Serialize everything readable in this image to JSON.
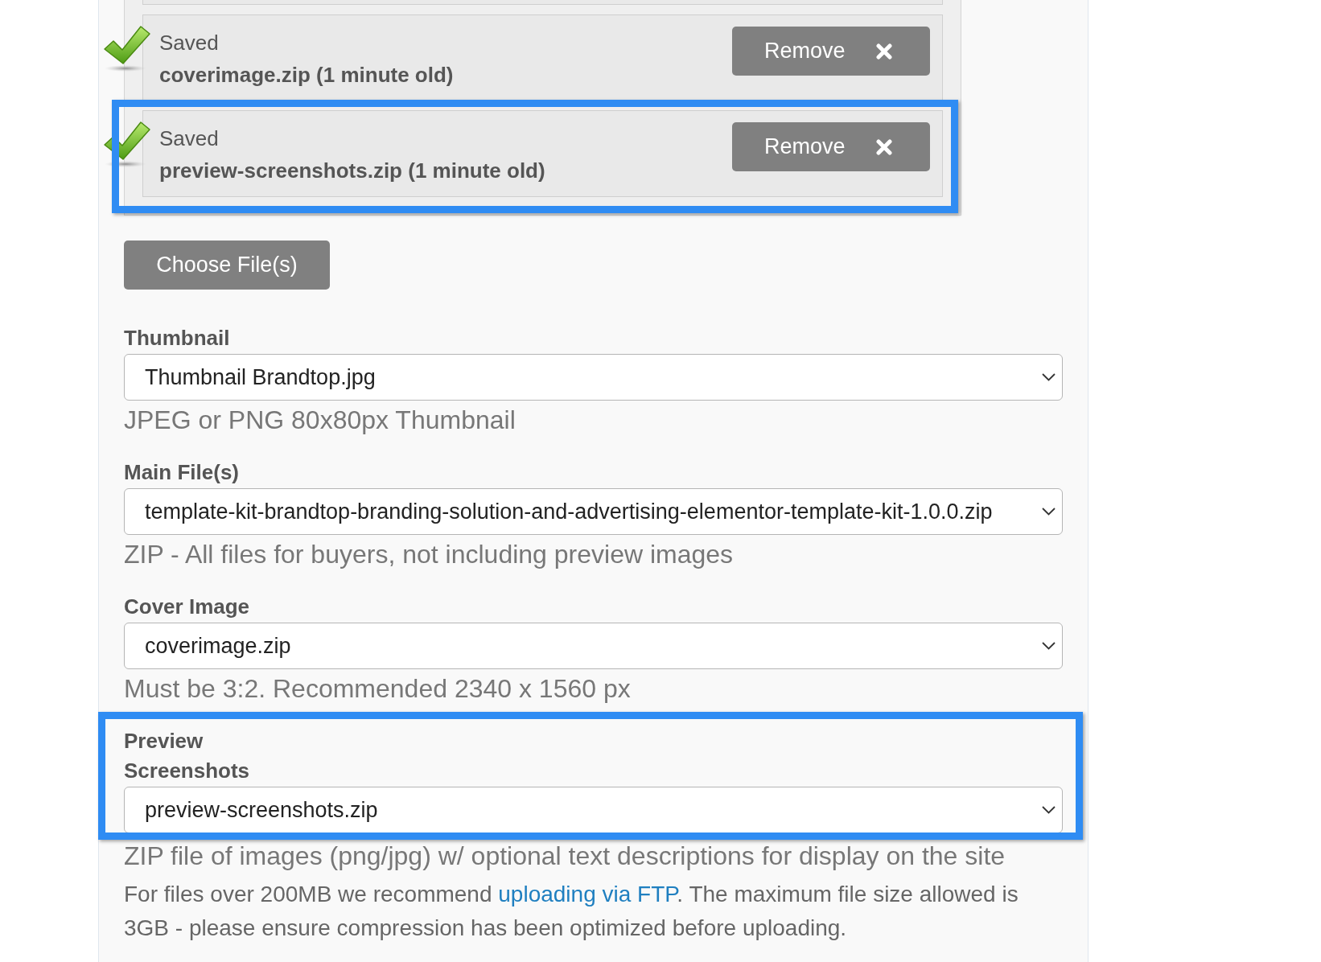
{
  "uploads": [
    {
      "status": "Saved",
      "file": "coverimage.zip (1 minute old)",
      "saved": true,
      "highlighted": false,
      "button": "Remove"
    },
    {
      "status": "Saved",
      "file": "preview-screenshots.zip (1 minute old)",
      "saved": true,
      "highlighted": true,
      "button": "Remove"
    }
  ],
  "choose_button": "Choose File(s)",
  "fields": [
    {
      "label": "Thumbnail",
      "value": "Thumbnail Brandtop.jpg",
      "hint": "JPEG or PNG 80x80px Thumbnail",
      "highlighted": false
    },
    {
      "label": "Main File(s)",
      "value": "template-kit-brandtop-branding-solution-and-advertising-elementor-template-kit-1.0.0.zip",
      "hint": "ZIP - All files for buyers, not including preview images",
      "highlighted": false
    },
    {
      "label": "Cover Image",
      "value": "coverimage.zip",
      "hint": "Must be 3:2. Recommended 2340 x 1560 px",
      "highlighted": false
    },
    {
      "label": "Preview Screenshots",
      "value": "preview-screenshots.zip",
      "hint": "ZIP file of images (png/jpg) w/ optional text descriptions for display on the site",
      "highlighted": true
    }
  ],
  "note": {
    "before": "For files over 200MB we recommend ",
    "link": "uploading via FTP",
    "after": ". The maximum file size allowed is 3GB - please ensure compression has been optimized before uploading."
  }
}
